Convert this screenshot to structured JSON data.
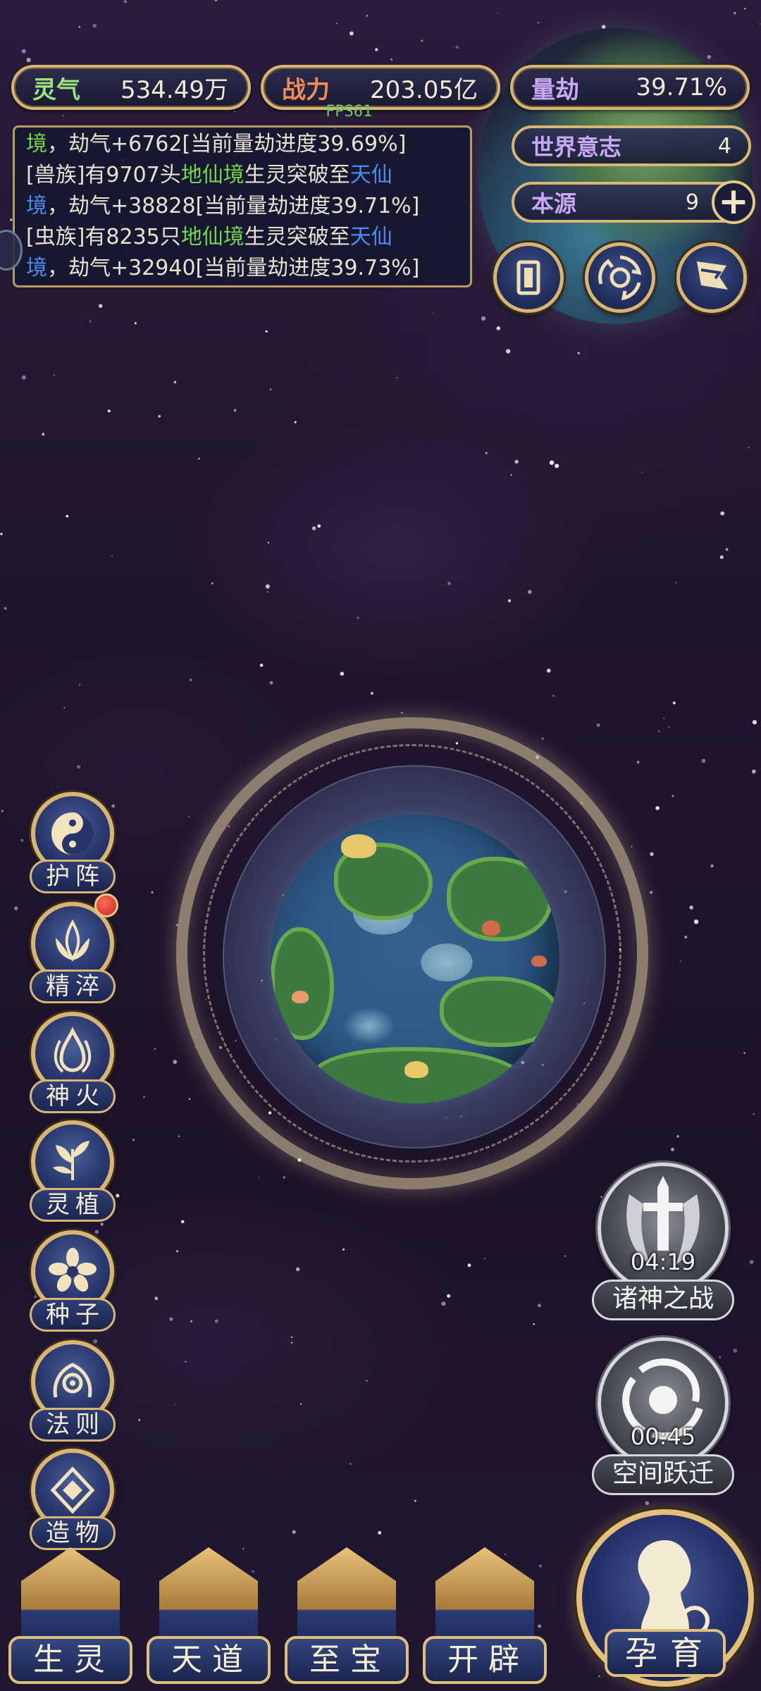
{
  "hud": {
    "lingqi": {
      "label": "灵气",
      "value": "534.49万"
    },
    "zhanli": {
      "label": "战力",
      "value": "203.05亿"
    },
    "liangjie": {
      "label": "量劫",
      "value": "39.71%"
    },
    "fps": "FPS61"
  },
  "world_panel": {
    "yizhi": {
      "label": "世界意志",
      "value": "4"
    },
    "benyuan": {
      "label": "本源",
      "value": "9"
    },
    "plus": "+"
  },
  "log": {
    "lines": [
      [
        {
          "t": "境",
          "c": "green"
        },
        {
          "t": "，劫气+6762[当前量劫进度39.69%]",
          "c": ""
        }
      ],
      [
        {
          "t": "[兽族]有9707头",
          "c": ""
        },
        {
          "t": "地仙境",
          "c": "green"
        },
        {
          "t": "生灵突破至",
          "c": ""
        },
        {
          "t": "天仙",
          "c": "blue"
        }
      ],
      [
        {
          "t": "境",
          "c": "blue"
        },
        {
          "t": "，劫气+38828[当前量劫进度39.71%]",
          "c": ""
        }
      ],
      [
        {
          "t": "[虫族]有8235只",
          "c": ""
        },
        {
          "t": "地仙境",
          "c": "green"
        },
        {
          "t": "生灵突破至",
          "c": ""
        },
        {
          "t": "天仙",
          "c": "blue"
        }
      ],
      [
        {
          "t": "境",
          "c": "blue"
        },
        {
          "t": "，劫气+32940[当前量劫进度39.73%]",
          "c": ""
        }
      ]
    ]
  },
  "side_menu": {
    "items": [
      {
        "label": "护阵",
        "icon": "yin-yang-icon"
      },
      {
        "label": "精淬",
        "icon": "lotus-flame-icon",
        "badge": true
      },
      {
        "label": "神火",
        "icon": "flame-icon"
      },
      {
        "label": "灵植",
        "icon": "plant-icon"
      },
      {
        "label": "种子",
        "icon": "seed-flower-icon"
      },
      {
        "label": "法则",
        "icon": "rune-icon"
      },
      {
        "label": "造物",
        "icon": "diamond-emblem-icon"
      }
    ]
  },
  "events": {
    "zhushen": {
      "label": "诸神之战",
      "timer": "04:19",
      "icon": "sword-wings-icon"
    },
    "kongjian": {
      "label": "空间跃迁",
      "timer": "00:45",
      "icon": "vortex-icon"
    }
  },
  "bottom_nav": {
    "shengling": "生灵",
    "tiandao": "天道",
    "zhibao": "至宝",
    "kaipi": "开辟",
    "yunyu": "孕育"
  },
  "colors": {
    "gold": "#d8b574",
    "green_text": "#72d64a",
    "blue_text": "#4d8cf0"
  }
}
